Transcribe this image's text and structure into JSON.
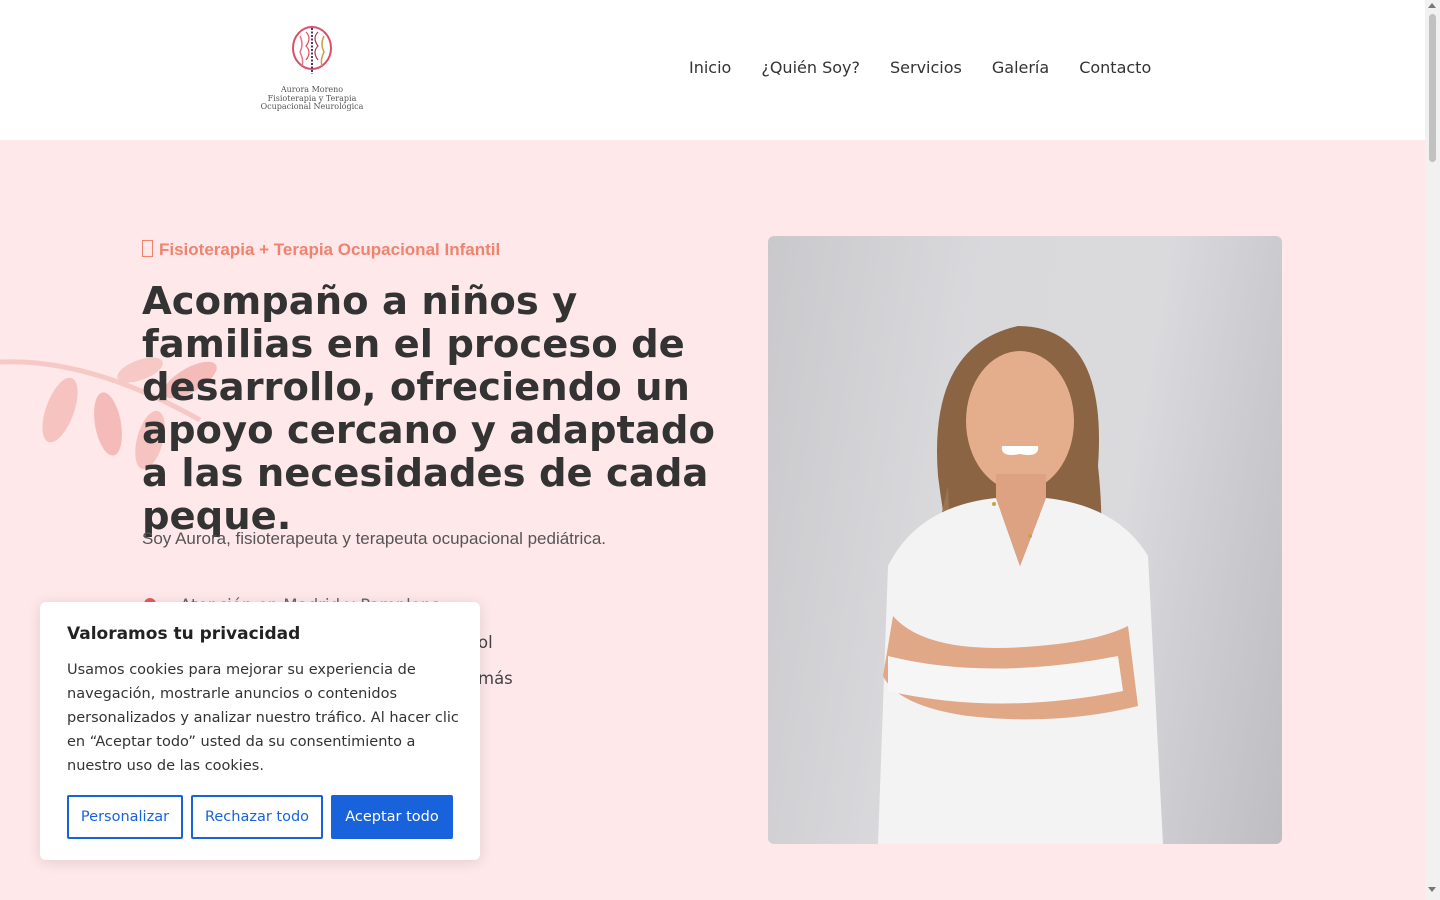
{
  "brand": {
    "logo_lines": [
      "Aurora Moreno",
      "Fisioterapia y Terapia",
      "Ocupacional Neurológica"
    ]
  },
  "nav": {
    "items": [
      "Inicio",
      "¿Quién Soy?",
      "Servicios",
      "Galería",
      "Contacto"
    ]
  },
  "hero": {
    "eyebrow": "Fisioterapia + Terapia Ocupacional Infantil",
    "headline": "Acompaño a niños y familias en el proceso de desarrollo, ofreciendo un apoyo cercano y adaptado a las necesidades de cada peque.",
    "subtitle": "Soy Aurora, fisioterapeuta y terapeuta ocupacional pediátrica.",
    "bullets": [
      "Atención en Madrid y Pamplona",
      "ol",
      "más"
    ]
  },
  "cookie": {
    "title": "Valoramos tu privacidad",
    "text": "Usamos cookies para mejorar su experiencia de navegación, mostrarle anuncios o contenidos personalizados y analizar nuestro tráfico. Al hacer clic en “Aceptar todo” usted da su consentimiento a nuestro uso de las cookies.",
    "customize_label": "Personalizar",
    "reject_label": "Rechazar todo",
    "accept_label": "Aceptar todo"
  },
  "colors": {
    "accent": "#f0826e",
    "hero_bg": "#ffe8ea",
    "button_blue": "#1863dc"
  },
  "icons": {
    "eyebrow": "missing-glyph-icon",
    "bullet": "map-pin-icon",
    "logo": "brain-spine-icon"
  }
}
